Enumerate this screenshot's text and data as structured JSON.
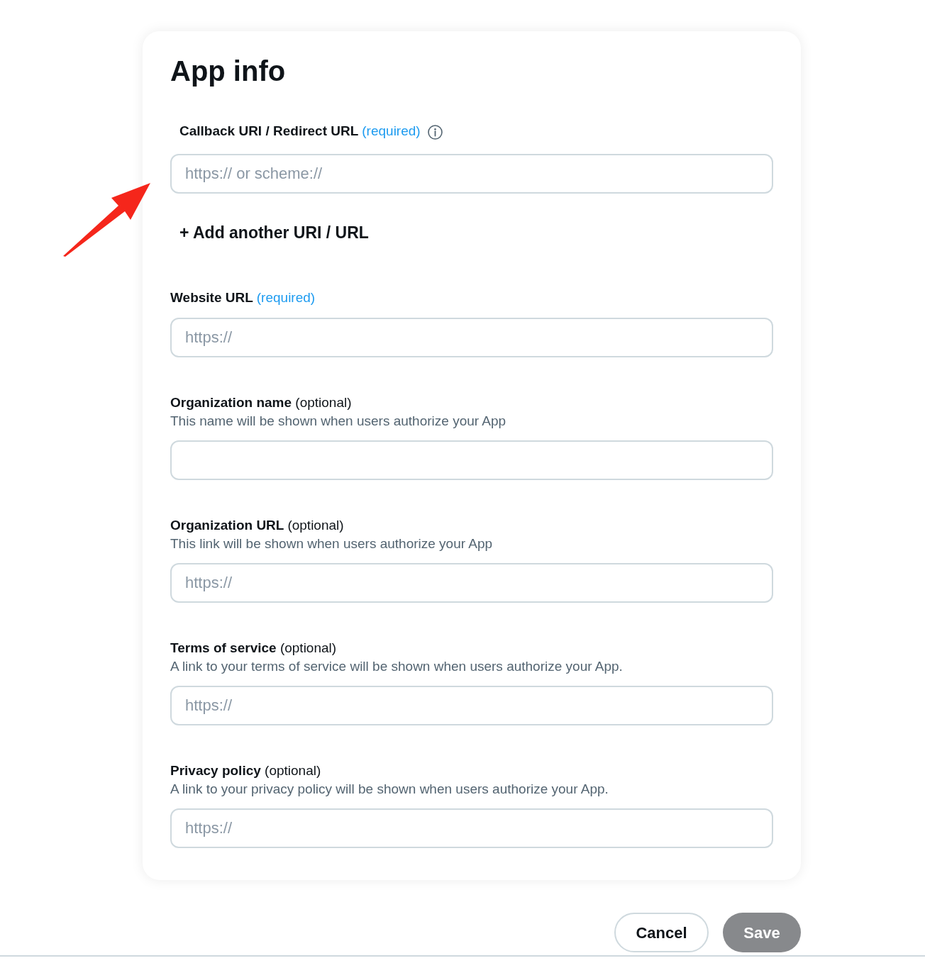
{
  "title": "App info",
  "callback": {
    "label": "Callback URI / Redirect URL",
    "tag": {
      "text": "(required)",
      "kind": "required"
    },
    "info_icon": true,
    "placeholder": "https:// or scheme://",
    "add_link": "+ Add another URI / URL"
  },
  "fields": [
    {
      "label": "Website URL",
      "tag": {
        "text": "(required)",
        "kind": "required"
      },
      "placeholder": "https://"
    },
    {
      "label": "Organization name",
      "tag": {
        "text": "(optional)",
        "kind": "optional"
      },
      "description": "This name will be shown when users authorize your App"
    },
    {
      "label": "Organization URL",
      "tag": {
        "text": "(optional)",
        "kind": "optional"
      },
      "description": "This link will be shown when users authorize your App",
      "placeholder": "https://"
    },
    {
      "label": "Terms of service",
      "tag": {
        "text": "(optional)",
        "kind": "optional"
      },
      "description": "A link to your terms of service will be shown when users authorize your App.",
      "placeholder": "https://"
    },
    {
      "label": "Privacy policy",
      "tag": {
        "text": "(optional)",
        "kind": "optional"
      },
      "description": "A link to your privacy policy will be shown when users authorize your App.",
      "placeholder": "https://"
    }
  ],
  "buttons": [
    {
      "label": "Cancel",
      "kind": "secondary",
      "disabled": false
    },
    {
      "label": "Save",
      "kind": "primary",
      "disabled": true
    }
  ]
}
